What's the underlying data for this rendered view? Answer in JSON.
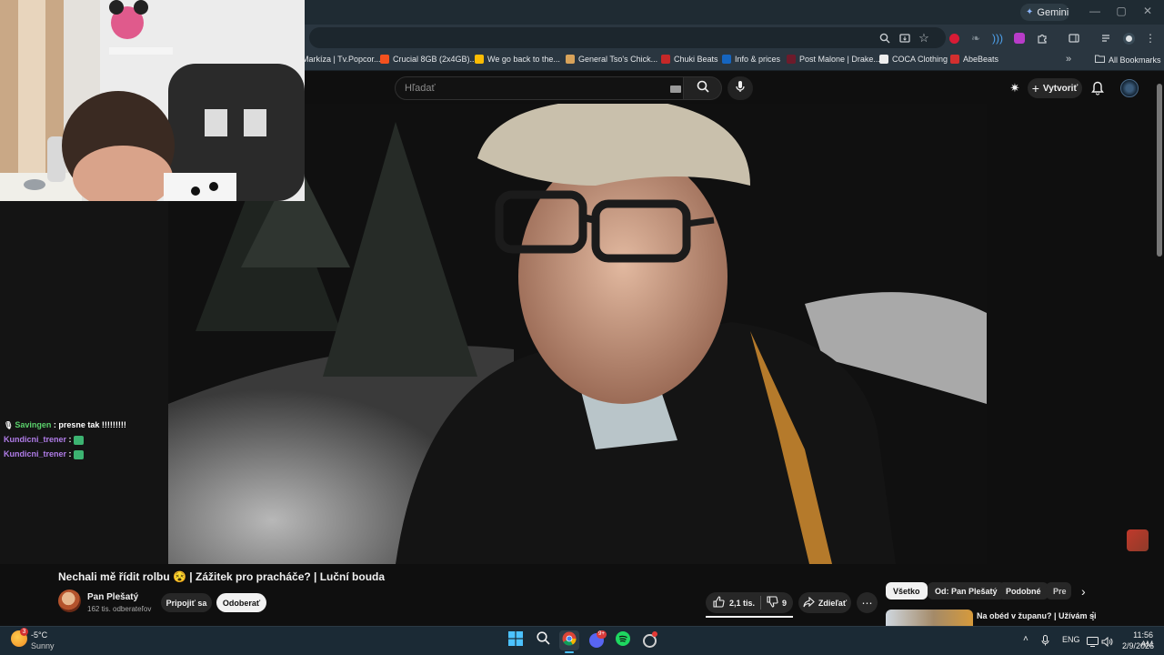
{
  "browser": {
    "gemini_label": "Gemini",
    "window_controls": [
      "—",
      "▢",
      "✕"
    ],
    "bookmarks": [
      {
        "label": "Markíza | Tv.Popcor...",
        "color": "#e53935"
      },
      {
        "label": "Crucial 8GB (2x4GB)...",
        "color": "#f4511e"
      },
      {
        "label": "We go back to the...",
        "color": "#fbbc04"
      },
      {
        "label": "General Tso's Chick...",
        "color": "#d8a35a"
      },
      {
        "label": "Chuki Beats",
        "color": "#c62828"
      },
      {
        "label": "Info & prices",
        "color": "#1565c0"
      },
      {
        "label": "Post Malone | Drake...",
        "color": "#6d1b2b"
      },
      {
        "label": "COCA Clothing",
        "color": "#eeeeee"
      },
      {
        "label": "AbeBeats",
        "color": "#d32f2f"
      }
    ],
    "bookmarks_overflow": "»",
    "all_bookmarks": "All Bookmarks"
  },
  "youtube": {
    "search_placeholder": "Hľadať",
    "create_label": "Vytvoriť",
    "video_title": "Nechali mě řídit rolbu 😵 | Zážitek pro pracháče? | Luční bouda",
    "channel_name": "Pan Plešatý",
    "channel_subs": "162 tis. odberateľov",
    "join_label": "Pripojiť sa",
    "subscribe_label": "Odoberať",
    "likes": "2,1 tis.",
    "dislikes": "9",
    "share_label": "Zdieľať",
    "chips": [
      "Všetko",
      "Od: Pan Plešatý",
      "Podobné",
      "Pre"
    ],
    "rec_title": "Na obéd v županu? | Užívám si"
  },
  "chat": [
    {
      "user": "Savingen",
      "message": "presne tak !!!!!!!!!",
      "color": "#5ad16b",
      "badge": true
    },
    {
      "user": "Kundicni_trener",
      "message": "",
      "color": "#b07ce8",
      "badge": false
    },
    {
      "user": "Kundicni_trener",
      "message": "",
      "color": "#b07ce8",
      "badge": false
    }
  ],
  "taskbar": {
    "weather_temp": "-5°C",
    "weather_desc": "Sunny",
    "weather_badge": "3",
    "lang": "ENG",
    "time": "11:56 AM",
    "date": "2/9/2026",
    "discord_badge": "9+"
  }
}
